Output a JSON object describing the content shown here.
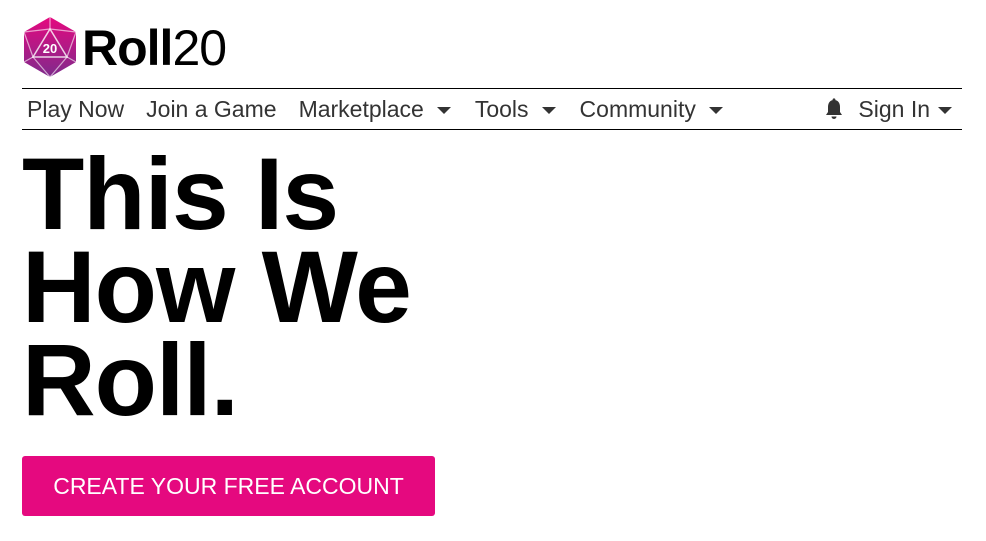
{
  "brand": {
    "logo_icon": "d20-die-icon",
    "die_number": "20",
    "name_part1": "Roll",
    "name_part2": "20",
    "color_primary": "#e5097f",
    "color_secondary": "#7e2a8c"
  },
  "nav": {
    "items": [
      {
        "label": "Play Now",
        "has_dropdown": false
      },
      {
        "label": "Join a Game",
        "has_dropdown": false
      },
      {
        "label": "Marketplace",
        "has_dropdown": true
      },
      {
        "label": "Tools",
        "has_dropdown": true
      },
      {
        "label": "Community",
        "has_dropdown": true
      }
    ],
    "notification_icon": "bell-icon",
    "signin_label": "Sign In",
    "caret_icon": "caret-down-icon"
  },
  "hero": {
    "line1": "This Is",
    "line2": "How We",
    "line3": "Roll."
  },
  "cta": {
    "label": "CREATE YOUR FREE ACCOUNT",
    "color": "#e5097f"
  }
}
